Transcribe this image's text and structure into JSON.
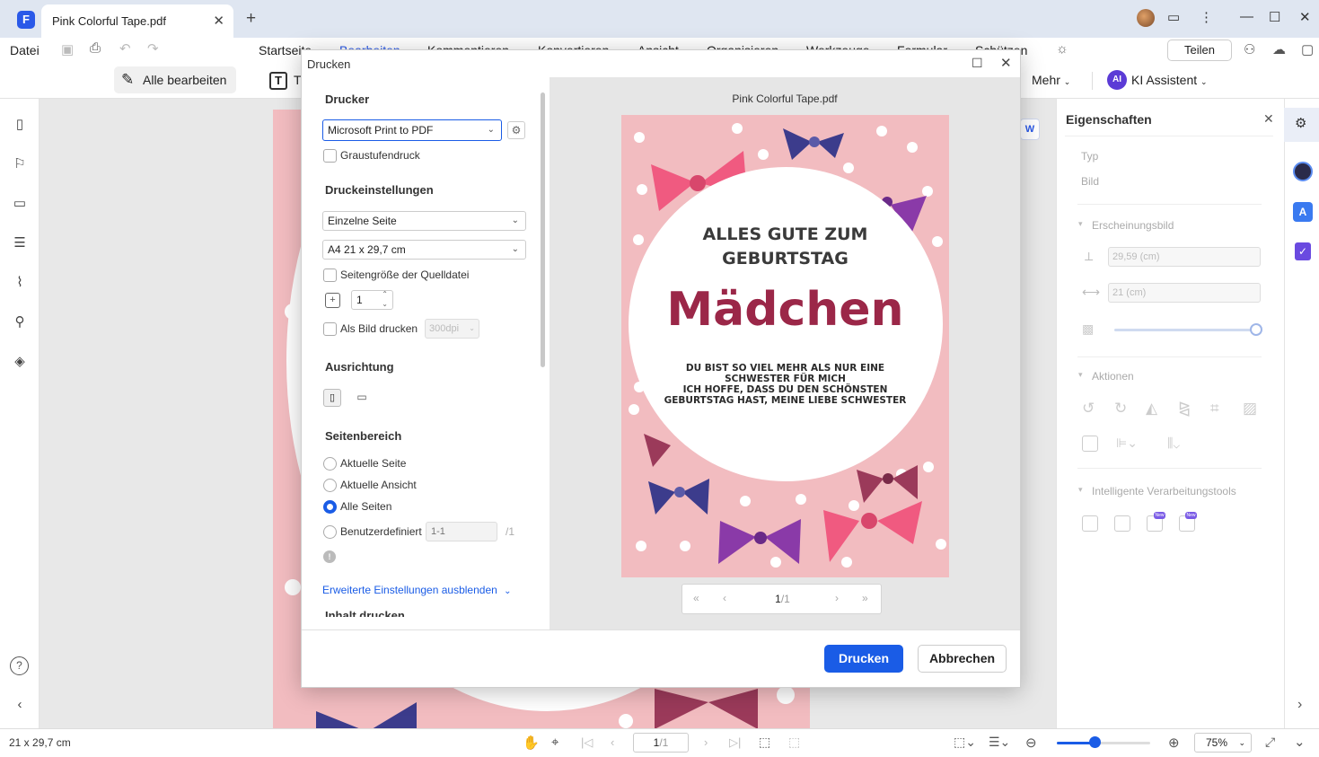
{
  "app": {
    "tab_title": "Pink Colorful Tape.pdf",
    "logo": "F"
  },
  "menu": {
    "file": "Datei",
    "items": [
      "Startseite",
      "Bearbeiten",
      "Kommentieren",
      "Konvertieren",
      "Ansicht",
      "Organisieren",
      "Werkzeuge",
      "Formular",
      "Schützen"
    ],
    "share": "Teilen"
  },
  "toolbar": {
    "edit_all": "Alle bearbeiten",
    "text_partial": "T",
    "more": "Mehr",
    "ai_badge": "AI",
    "ai_assistant": "KI Assistent"
  },
  "properties": {
    "title": "Eigenschaften",
    "type_label": "Typ",
    "type_value": "Bild",
    "appearance": "Erscheinungsbild",
    "height": "29,59 (cm)",
    "width": "21 (cm)",
    "opacity_percent": 100,
    "actions": "Aktionen",
    "smart_tools": "Intelligente Verarbeitungstools",
    "new_badge": "New"
  },
  "dialog": {
    "title": "Drucken",
    "printer_section": "Drucker",
    "printer": "Microsoft Print to PDF",
    "grayscale": "Graustufendruck",
    "settings_section": "Druckeinstellungen",
    "page_mode": "Einzelne Seite",
    "paper_size": "A4 21 x 29,7 cm",
    "source_size": "Seitengröße der Quelldatei",
    "copies": "1",
    "print_as_image": "Als Bild drucken",
    "dpi": "300dpi",
    "orientation_section": "Ausrichtung",
    "range_section": "Seitenbereich",
    "range_options": [
      "Aktuelle Seite",
      "Aktuelle Ansicht",
      "Alle Seiten",
      "Benutzerdefiniert"
    ],
    "selected_range": "Alle Seiten",
    "custom_range_placeholder": "1-1",
    "custom_range_total": "/1",
    "advanced_link": "Erweiterte Einstellungen ausblenden",
    "content_section_partial": "Inhalt drucken",
    "preview_filename": "Pink Colorful Tape.pdf",
    "page_current": "1",
    "page_total": "/1",
    "print_button": "Drucken",
    "cancel_button": "Abbrechen"
  },
  "card": {
    "line1": "ALLES GUTE ZUM",
    "line2": "GEBURTSTAG",
    "name": "Mädchen",
    "msg1": "DU BIST SO VIEL MEHR ALS NUR EINE",
    "msg2": "SCHWESTER FÜR MICH",
    "msg3": "ICH HOFFE, DASS DU DEN SCHÖNSTEN",
    "msg4": "GEBURTSTAG HAST, MEINE LIEBE SCHWESTER"
  },
  "status": {
    "page_size": "21 x 29,7 cm",
    "page_current": "1",
    "page_total": "/1",
    "zoom": "75%",
    "zoom_fraction": 0.4
  },
  "colors": {
    "accent": "#1a5ce6",
    "card_bg": "#f2bcc0",
    "card_title": "#9b2748",
    "bow_pink": "#f05a80",
    "bow_purple": "#8a3aa8",
    "bow_navy": "#3c3c8c",
    "bow_maroon": "#9b3a5a"
  }
}
